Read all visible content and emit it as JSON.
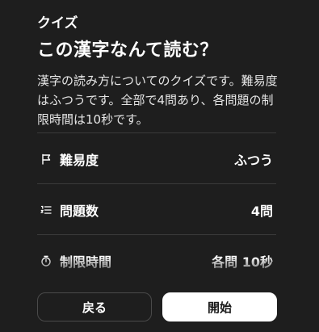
{
  "header": {
    "kicker": "クイズ",
    "title": "この漢字なんて読む？"
  },
  "description": "漢字の読み方についてのクイズです。難易度はふつうです。全部で4問あり、各問題の制限時間は10秒です。",
  "details": [
    {
      "icon": "flag-icon",
      "label": "難易度",
      "value": "ふつう"
    },
    {
      "icon": "numbered-list-icon",
      "label": "問題数",
      "value": "4問"
    },
    {
      "icon": "timer-icon",
      "label": "制限時間",
      "value": "各問 10秒"
    }
  ],
  "actions": {
    "back_label": "戻る",
    "start_label": "開始"
  },
  "colors": {
    "background": "#1e1e1e",
    "text": "#ffffff",
    "divider": "#3a3a3a",
    "primary_button_bg": "#ffffff",
    "primary_button_text": "#1a1a1a"
  }
}
